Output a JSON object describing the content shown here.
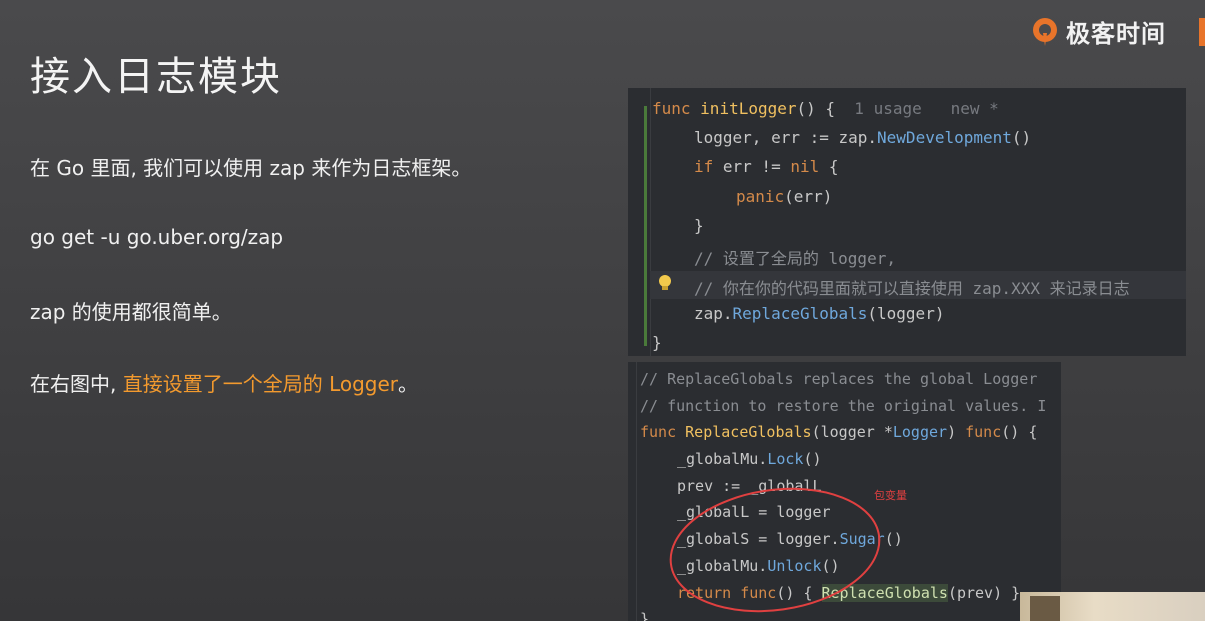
{
  "brand": {
    "name": "极客时间"
  },
  "slide": {
    "title": "接入日志模块",
    "bullets": [
      "在 Go 里面, 我们可以使用 zap 来作为日志框架。",
      "go get -u go.uber.org/zap",
      "zap 的使用都很简单。"
    ],
    "bullet4_prefix": "在右图中, ",
    "bullet4_highlight": "直接设置了一个全局的 Logger",
    "bullet4_suffix": "。"
  },
  "code_top": {
    "l1_kw": "func",
    "l1_fn": "initLogger",
    "l1_rest": "() {",
    "l1_hint": "1 usage   new *",
    "l2_a": "logger, err := zap.",
    "l2_call": "NewDevelopment",
    "l2_b": "()",
    "l3_kw": "if",
    "l3_a": " err != ",
    "l3_nil": "nil",
    "l3_b": " {",
    "l4_fn": "panic",
    "l4_b": "(err)",
    "l5": "}",
    "l6": "// 设置了全局的 logger,",
    "l7": "// 你在你的代码里面就可以直接使用 zap.XXX 来记录日志",
    "l8_a": "zap.",
    "l8_call": "ReplaceGlobals",
    "l8_b": "(logger)",
    "l9": "}"
  },
  "code_bottom": {
    "l1": "// ReplaceGlobals replaces the global Logger",
    "l2": "// function to restore the original values. I",
    "l3_kw": "func",
    "l3_fn": "ReplaceGlobals",
    "l3_a": "(logger *",
    "l3_typ": "Logger",
    "l3_b": ") ",
    "l3_kw2": "func",
    "l3_c": "() {",
    "l4_a": "_globalMu.",
    "l4_call": "Lock",
    "l4_b": "()",
    "l5": "prev := _globalL",
    "l6": "_globalL = logger",
    "l7_a": "_globalS = logger.",
    "l7_call": "Sugar",
    "l7_b": "()",
    "l8_a": "_globalMu.",
    "l8_call": "Unlock",
    "l8_b": "()",
    "l9_kw": "return",
    "l9_kw2": "func",
    "l9_a": "() { ",
    "l9_sel": "ReplaceGlobals",
    "l9_b": "(prev) }",
    "l10": "}"
  },
  "annotation": {
    "note": "包变量",
    "color": "#e04040"
  }
}
